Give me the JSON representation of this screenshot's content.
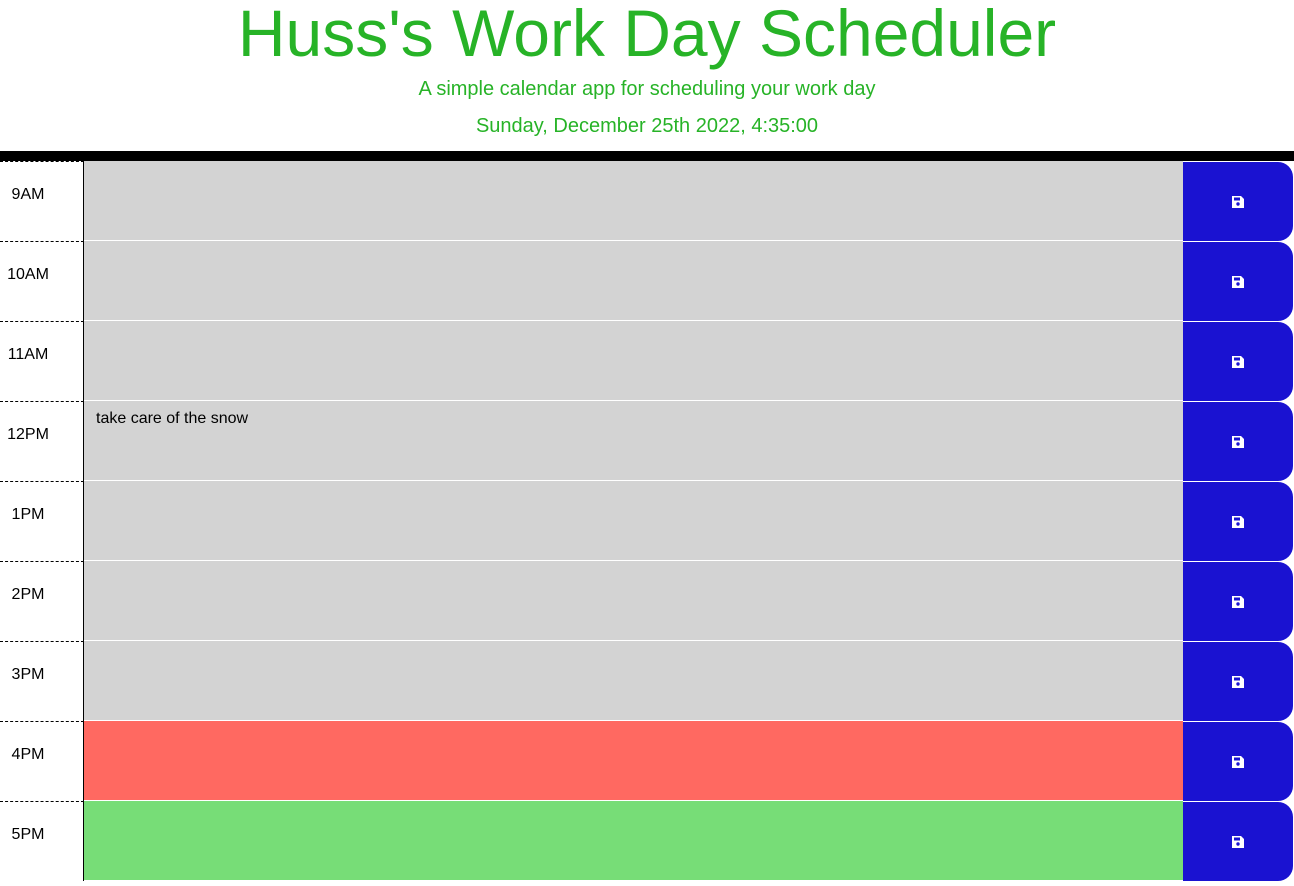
{
  "header": {
    "title": "Huss's Work Day Scheduler",
    "subtitle": "A simple calendar app for scheduling your work day",
    "current_day": "Sunday, December 25th 2022, 4:35:00"
  },
  "colors": {
    "title_green": "#27b327",
    "past": "#d3d3d3",
    "present": "#ff6961",
    "future": "#77dd77",
    "save_button": "#1a12d1"
  },
  "time_blocks": [
    {
      "hour": "9AM",
      "text": "",
      "state": "past"
    },
    {
      "hour": "10AM",
      "text": "",
      "state": "past"
    },
    {
      "hour": "11AM",
      "text": "",
      "state": "past"
    },
    {
      "hour": "12PM",
      "text": "take care of the snow",
      "state": "past"
    },
    {
      "hour": "1PM",
      "text": "",
      "state": "past"
    },
    {
      "hour": "2PM",
      "text": "",
      "state": "past"
    },
    {
      "hour": "3PM",
      "text": "",
      "state": "past"
    },
    {
      "hour": "4PM",
      "text": "",
      "state": "present"
    },
    {
      "hour": "5PM",
      "text": "",
      "state": "future"
    }
  ],
  "save_icon": "floppy-disk-icon"
}
